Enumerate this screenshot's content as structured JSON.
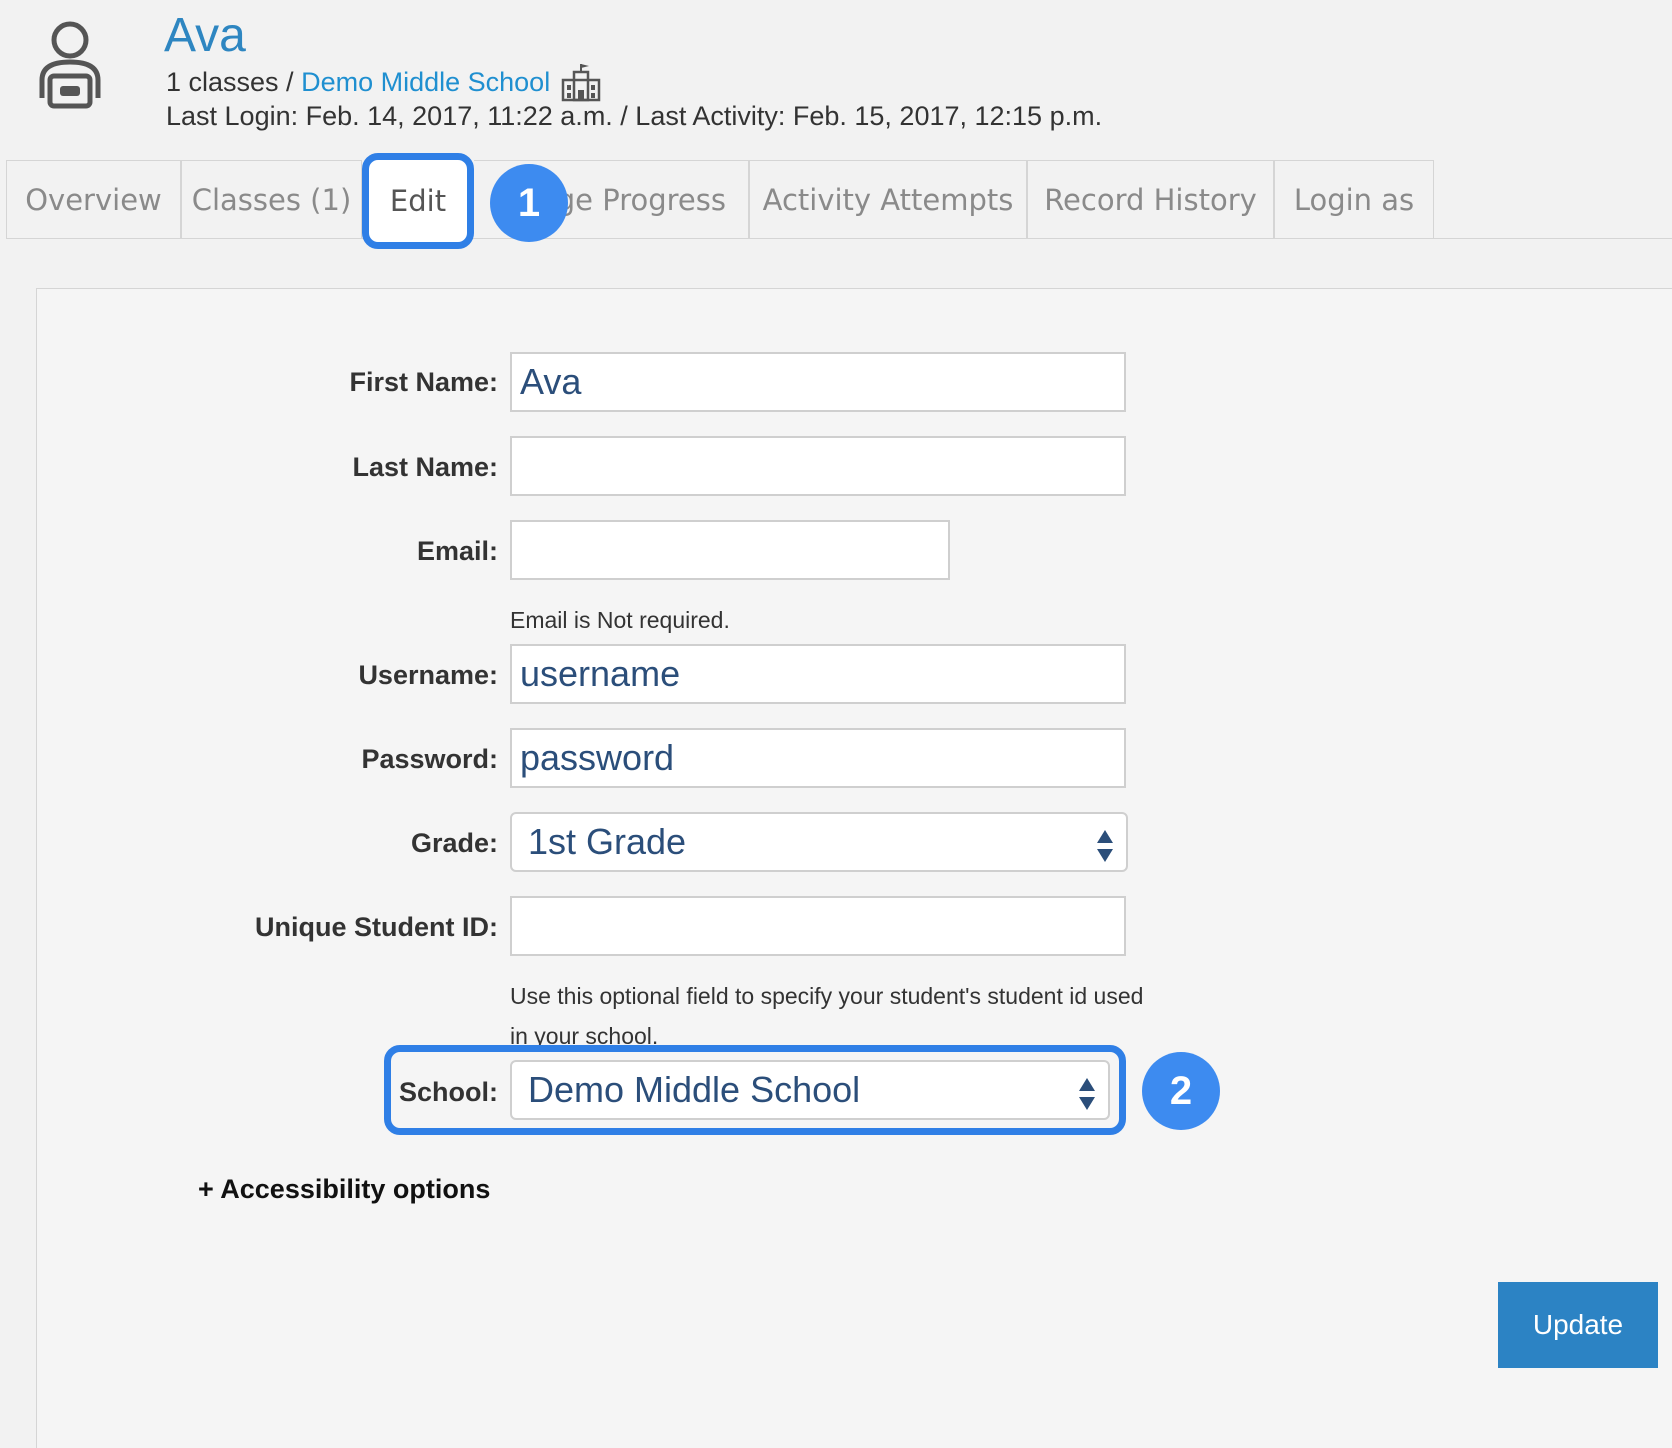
{
  "profile": {
    "name": "Ava",
    "classes_text": "1 classes / ",
    "school_link": "Demo Middle School",
    "login_line": "Last Login: Feb. 14, 2017, 11:22 a.m. / Last Activity: Feb. 15, 2017, 12:15 p.m."
  },
  "tabs": [
    {
      "label": "Overview"
    },
    {
      "label": "Classes (1)"
    },
    {
      "label": "Edit",
      "active": true
    },
    {
      "label": "ge Progress"
    },
    {
      "label": "Activity Attempts"
    },
    {
      "label": "Record History"
    },
    {
      "label": "Login as"
    }
  ],
  "badges": {
    "one": "1",
    "two": "2"
  },
  "form": {
    "first_name": {
      "label": "First Name:",
      "value": "Ava"
    },
    "last_name": {
      "label": "Last Name:",
      "value": ""
    },
    "email": {
      "label": "Email:",
      "value": "",
      "help": "Email is Not required."
    },
    "username": {
      "label": "Username:",
      "value": "username"
    },
    "password": {
      "label": "Password:",
      "value": "password"
    },
    "grade": {
      "label": "Grade:",
      "value": "1st Grade"
    },
    "student_id": {
      "label": "Unique Student ID:",
      "value": "",
      "help_line1": "Use this optional field to specify your student's student id used",
      "help_line2": "in your school."
    },
    "school": {
      "label": "School:",
      "value": "Demo Middle School"
    },
    "accessibility": "+ Accessibility options",
    "update_label": "Update"
  },
  "colors": {
    "accent": "#2f7fe6",
    "link": "#1f8fd0",
    "button": "#2c83c4"
  }
}
